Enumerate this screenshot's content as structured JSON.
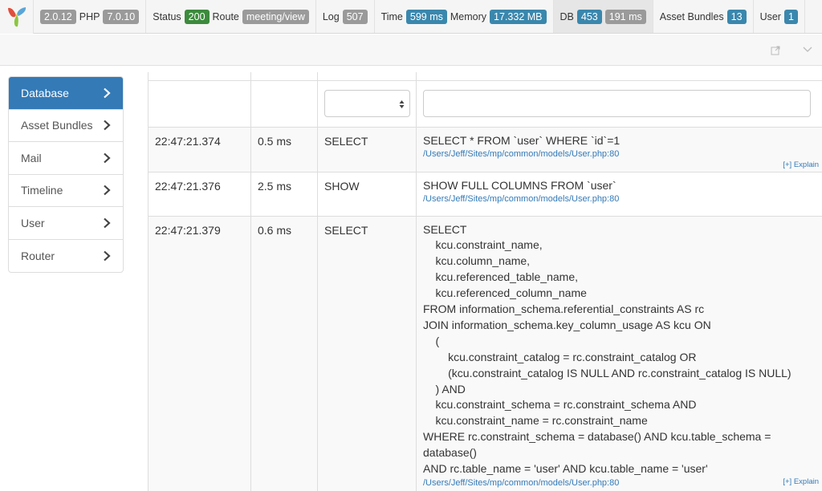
{
  "toolbar": {
    "yii_version": "2.0.12",
    "php_label": "PHP",
    "php_version": "7.0.10",
    "status_label": "Status",
    "status_code": "200",
    "route_label": "Route",
    "route_value": "meeting/view",
    "log_label": "Log",
    "log_count": "507",
    "time_label": "Time",
    "time_value": "599 ms",
    "memory_label": "Memory",
    "memory_value": "17.332 MB",
    "db_label": "DB",
    "db_count": "453",
    "db_time": "191 ms",
    "asset_label": "Asset Bundles",
    "asset_count": "13",
    "user_label": "User",
    "user_count": "1"
  },
  "sidebar": {
    "items": [
      {
        "label": "Database",
        "active": true
      },
      {
        "label": "Asset Bundles",
        "active": false
      },
      {
        "label": "Mail",
        "active": false
      },
      {
        "label": "Timeline",
        "active": false
      },
      {
        "label": "User",
        "active": false
      },
      {
        "label": "Router",
        "active": false
      }
    ]
  },
  "filters": {
    "type_select_value": "",
    "query_input_value": ""
  },
  "rows": [
    {
      "time": "22:47:21.374",
      "duration": "0.5 ms",
      "type": "SELECT",
      "query": "SELECT * FROM `user` WHERE `id`=1",
      "trace": "/Users/Jeff/Sites/mp/common/models/User.php:80",
      "explain": "[+] Explain"
    },
    {
      "time": "22:47:21.376",
      "duration": "2.5 ms",
      "type": "SHOW",
      "query": "SHOW FULL COLUMNS FROM `user`",
      "trace": "/Users/Jeff/Sites/mp/common/models/User.php:80",
      "explain": ""
    },
    {
      "time": "22:47:21.379",
      "duration": "0.6 ms",
      "type": "SELECT",
      "query": "SELECT\n    kcu.constraint_name,\n    kcu.column_name,\n    kcu.referenced_table_name,\n    kcu.referenced_column_name\nFROM information_schema.referential_constraints AS rc\nJOIN information_schema.key_column_usage AS kcu ON\n    (\n        kcu.constraint_catalog = rc.constraint_catalog OR\n        (kcu.constraint_catalog IS NULL AND rc.constraint_catalog IS NULL)\n    ) AND\n    kcu.constraint_schema = rc.constraint_schema AND\n    kcu.constraint_name = rc.constraint_name\nWHERE rc.constraint_schema = database() AND kcu.table_schema =\ndatabase()\nAND rc.table_name = 'user' AND kcu.table_name = 'user'",
      "trace": "/Users/Jeff/Sites/mp/common/models/User.php:80",
      "explain": "[+] Explain"
    }
  ],
  "icons": {
    "logo": "yii-logo",
    "external": "external-link-icon",
    "collapse": "chevron-down-icon",
    "nav_arrow": "chevron-right-icon",
    "select_arrows": "sort-arrows-icon"
  },
  "colors": {
    "active_nav": "#337ab7",
    "badge_gray": "#9a9a9a",
    "badge_green": "#3c8a3c",
    "badge_blue": "#3a87ad",
    "link": "#337ab7"
  }
}
